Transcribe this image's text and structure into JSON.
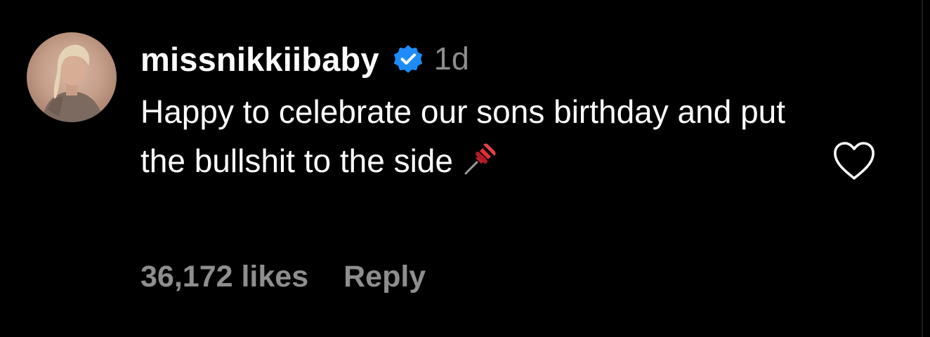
{
  "comment": {
    "username": "missnikkiibaby",
    "verified_icon": "verified-badge-icon",
    "timestamp": "1d",
    "text": "Happy to celebrate our sons birthday and put the bullshit to the side",
    "emoji_icon": "pushpin-icon",
    "likes": "36,172 likes",
    "reply_label": "Reply",
    "like_icon": "heart-outline-icon"
  },
  "colors": {
    "background": "#000000",
    "text_primary": "#ffffff",
    "text_secondary": "#8e8e8e",
    "verified_blue": "#1d8cf8"
  }
}
